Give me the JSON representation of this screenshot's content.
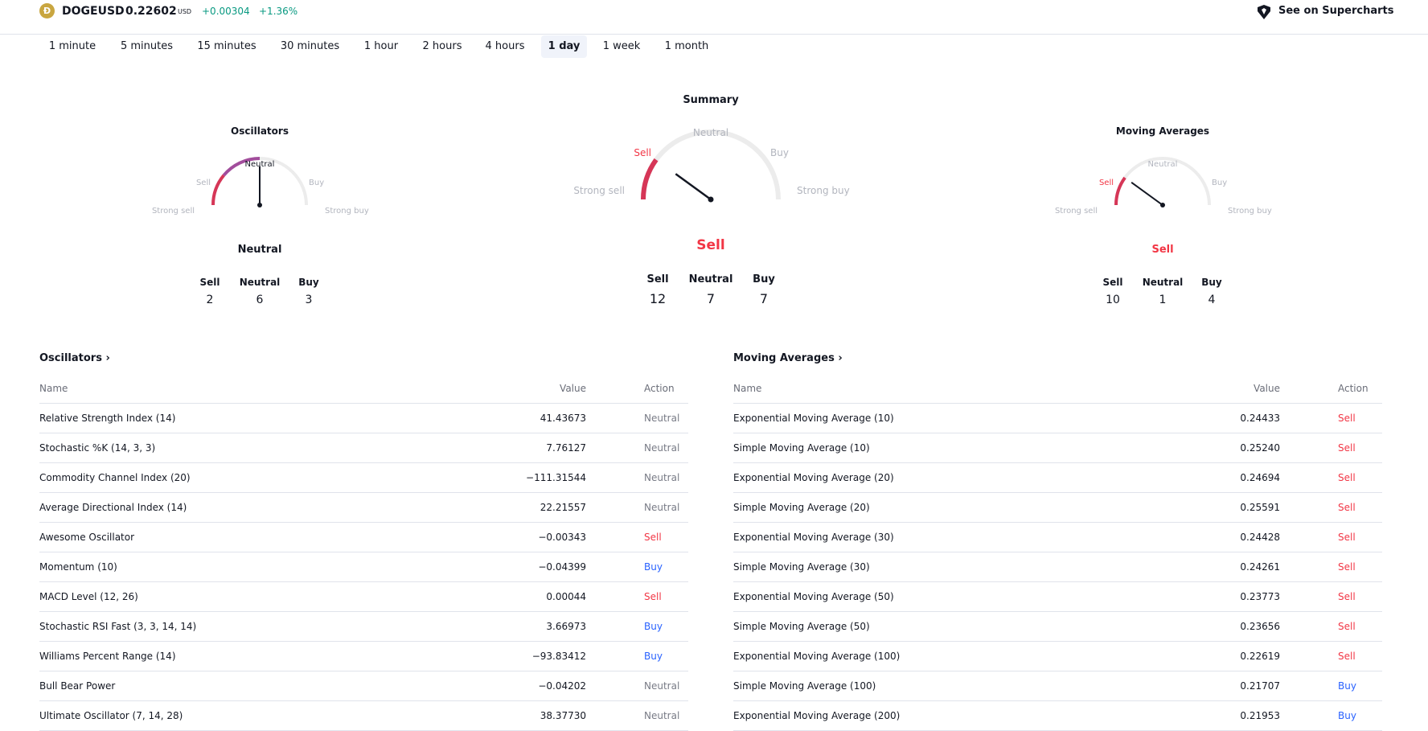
{
  "header": {
    "symbol": "DOGEUSD",
    "price": "0.22602",
    "currency": "USD",
    "change": "+0.00304",
    "change_percent": "+1.36%",
    "supercharts_link": "See on Supercharts"
  },
  "intervals": [
    "1 minute",
    "5 minutes",
    "15 minutes",
    "30 minutes",
    "1 hour",
    "2 hours",
    "4 hours",
    "1 day",
    "1 week",
    "1 month"
  ],
  "active_interval": "1 day",
  "gauge_labels": {
    "strong_sell": "Strong sell",
    "sell": "Sell",
    "neutral": "Neutral",
    "buy": "Buy",
    "strong_buy": "Strong buy"
  },
  "gauges": {
    "oscillators": {
      "title": "Oscillators",
      "verdict": "Neutral",
      "active_label": "neutral",
      "needle_value": 0.5,
      "sell_label": "Sell",
      "neutral_label": "Neutral",
      "buy_label": "Buy",
      "sell": "2",
      "neutral": "6",
      "buy": "3"
    },
    "summary": {
      "title": "Summary",
      "verdict": "Sell",
      "active_label": "sell",
      "needle_value": 0.2,
      "sell_label": "Sell",
      "neutral_label": "Neutral",
      "buy_label": "Buy",
      "sell": "12",
      "neutral": "7",
      "buy": "7"
    },
    "moving_averages": {
      "title": "Moving Averages",
      "verdict": "Sell",
      "active_label": "sell",
      "needle_value": 0.2,
      "sell_label": "Sell",
      "neutral_label": "Neutral",
      "buy_label": "Buy",
      "sell": "10",
      "neutral": "1",
      "buy": "4"
    }
  },
  "oscillators_table": {
    "title": "Oscillators",
    "columns": {
      "name": "Name",
      "value": "Value",
      "action": "Action"
    },
    "rows": [
      {
        "name": "Relative Strength Index (14)",
        "value": "41.43673",
        "action": "Neutral"
      },
      {
        "name": "Stochastic %K (14, 3, 3)",
        "value": "7.76127",
        "action": "Neutral"
      },
      {
        "name": "Commodity Channel Index (20)",
        "value": "−111.31544",
        "action": "Neutral"
      },
      {
        "name": "Average Directional Index (14)",
        "value": "22.21557",
        "action": "Neutral"
      },
      {
        "name": "Awesome Oscillator",
        "value": "−0.00343",
        "action": "Sell"
      },
      {
        "name": "Momentum (10)",
        "value": "−0.04399",
        "action": "Buy"
      },
      {
        "name": "MACD Level (12, 26)",
        "value": "0.00044",
        "action": "Sell"
      },
      {
        "name": "Stochastic RSI Fast (3, 3, 14, 14)",
        "value": "3.66973",
        "action": "Buy"
      },
      {
        "name": "Williams Percent Range (14)",
        "value": "−93.83412",
        "action": "Buy"
      },
      {
        "name": "Bull Bear Power",
        "value": "−0.04202",
        "action": "Neutral"
      },
      {
        "name": "Ultimate Oscillator (7, 14, 28)",
        "value": "38.37730",
        "action": "Neutral"
      }
    ]
  },
  "moving_averages_table": {
    "title": "Moving Averages",
    "columns": {
      "name": "Name",
      "value": "Value",
      "action": "Action"
    },
    "rows": [
      {
        "name": "Exponential Moving Average (10)",
        "value": "0.24433",
        "action": "Sell"
      },
      {
        "name": "Simple Moving Average (10)",
        "value": "0.25240",
        "action": "Sell"
      },
      {
        "name": "Exponential Moving Average (20)",
        "value": "0.24694",
        "action": "Sell"
      },
      {
        "name": "Simple Moving Average (20)",
        "value": "0.25591",
        "action": "Sell"
      },
      {
        "name": "Exponential Moving Average (30)",
        "value": "0.24428",
        "action": "Sell"
      },
      {
        "name": "Simple Moving Average (30)",
        "value": "0.24261",
        "action": "Sell"
      },
      {
        "name": "Exponential Moving Average (50)",
        "value": "0.23773",
        "action": "Sell"
      },
      {
        "name": "Simple Moving Average (50)",
        "value": "0.23656",
        "action": "Sell"
      },
      {
        "name": "Exponential Moving Average (100)",
        "value": "0.22619",
        "action": "Sell"
      },
      {
        "name": "Simple Moving Average (100)",
        "value": "0.21707",
        "action": "Buy"
      },
      {
        "name": "Exponential Moving Average (200)",
        "value": "0.21953",
        "action": "Buy"
      }
    ]
  },
  "colors": {
    "positive": "#089981",
    "sell": "#f23645",
    "buy": "#2962ff",
    "neutral": "#787b86",
    "track": "#ececec",
    "sell_fill": "#d63657",
    "neutral_fill": "#a24d9c"
  }
}
